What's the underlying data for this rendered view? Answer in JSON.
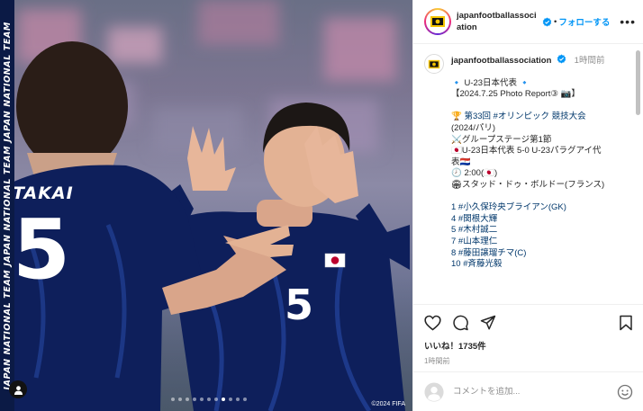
{
  "photo": {
    "side_text": "JAPAN NATIONAL TEAM JAPAN NATIONAL TEAM JAPAN NATIONAL TEAM",
    "jersey_name": "TAKAI",
    "jersey_number_left": "5",
    "jersey_number_right": "5",
    "copyright": "©2024 FIFA",
    "carousel": {
      "total": 11,
      "active": 8
    }
  },
  "header": {
    "username": "japanfootballassociation",
    "follow_label": "フォローする",
    "more_label": "•••"
  },
  "caption": {
    "username": "japanfootballassociation",
    "time": "1時間前",
    "lines": [
      "🔹 U-23日本代表 🔹",
      "【2024.7.25 Photo Report③ 📷】",
      "",
      "🏆 第33回 #オリンピック 競技大会",
      "(2024/パリ)",
      "⚔️グループステージ第1節",
      "🇯🇵U-23日本代表 5-0 U-23パラグアイ代",
      "表🇵🇾",
      "🕗 2:00(🇯🇵)",
      "🏟スタッド・ドゥ・ボルドー(フランス)",
      "",
      "1 #小久保玲央ブライアン(GK)",
      "4 #関根大輝",
      "5 #木村誠二",
      "7 #山本理仁",
      "8 #藤田譲瑠チマ(C)",
      "10 #斉藤光毅"
    ]
  },
  "actions": {
    "likes_text": "いいね！1735件",
    "time": "1時間前",
    "comment_placeholder": "コメントを追加..."
  },
  "colors": {
    "accent": "#0095f6",
    "jersey": "#0e1f5b",
    "strip": "#0b1a45"
  },
  "icons": [
    "heart-icon",
    "comment-icon",
    "share-icon",
    "bookmark-icon",
    "emoji-icon",
    "verified-icon",
    "more-icon",
    "user-tag-icon"
  ]
}
